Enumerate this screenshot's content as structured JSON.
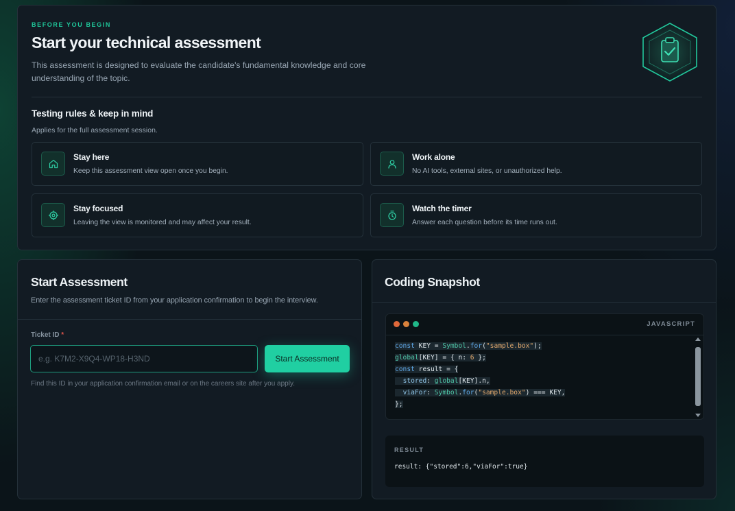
{
  "intro": {
    "eyebrow": "BEFORE YOU BEGIN",
    "title": "Start your technical assessment",
    "description": "This assessment is designed to evaluate the candidate's fundamental knowledge and core understanding of the topic.",
    "badge_icon": "clipboard-check-icon"
  },
  "rules": {
    "title": "Testing rules & keep in mind",
    "subtitle": "Applies for the full assessment session.",
    "items": [
      {
        "icon": "home-icon",
        "title": "Stay here",
        "desc": "Keep this assessment view open once you begin."
      },
      {
        "icon": "user-icon",
        "title": "Work alone",
        "desc": "No AI tools, external sites, or unauthorized help."
      },
      {
        "icon": "target-icon",
        "title": "Stay focused",
        "desc": "Leaving the view is monitored and may affect your result."
      },
      {
        "icon": "timer-icon",
        "title": "Watch the timer",
        "desc": "Answer each question before its time runs out."
      }
    ]
  },
  "start": {
    "title": "Start Assessment",
    "description": "Enter the assessment ticket ID from your application confirmation to begin the interview.",
    "field_label": "Ticket ID",
    "required_mark": "*",
    "input_value": "",
    "input_placeholder": "e.g. K7M2-X9Q4-WP18-H3ND",
    "button_label": "Start Assessment",
    "hint": "Find this ID in your application confirmation email or on the careers site after you apply."
  },
  "snapshot": {
    "title": "Coding Snapshot",
    "language": "JAVASCRIPT",
    "code_lines": [
      "const KEY = Symbol.for(\"sample.box\");",
      "global[KEY] = { n: 6 };",
      "const result = {",
      "  stored: global[KEY].n,",
      "  viaFor: Symbol.for(\"sample.box\") === KEY,",
      "};"
    ],
    "result_label": "RESULT",
    "result_value": "result: {\"stored\":6,\"viaFor\":true}"
  },
  "colors": {
    "accent": "#20cfa2",
    "dot_red": "#e0683a",
    "dot_yellow": "#d9823c",
    "dot_green": "#20b889",
    "required": "#e2564c"
  }
}
